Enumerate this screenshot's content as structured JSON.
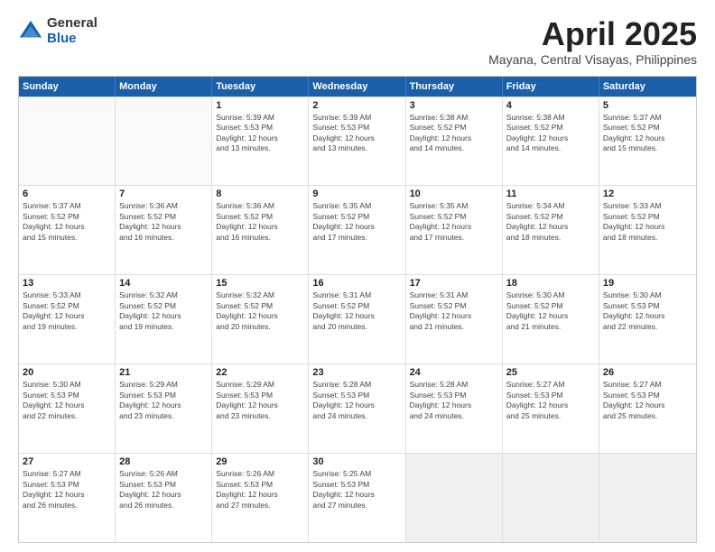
{
  "logo": {
    "general": "General",
    "blue": "Blue"
  },
  "title": {
    "month": "April 2025",
    "location": "Mayana, Central Visayas, Philippines"
  },
  "header_days": [
    "Sunday",
    "Monday",
    "Tuesday",
    "Wednesday",
    "Thursday",
    "Friday",
    "Saturday"
  ],
  "rows": [
    [
      {
        "day": "",
        "lines": [],
        "empty": true
      },
      {
        "day": "",
        "lines": [],
        "empty": true
      },
      {
        "day": "1",
        "lines": [
          "Sunrise: 5:39 AM",
          "Sunset: 5:53 PM",
          "Daylight: 12 hours",
          "and 13 minutes."
        ]
      },
      {
        "day": "2",
        "lines": [
          "Sunrise: 5:39 AM",
          "Sunset: 5:53 PM",
          "Daylight: 12 hours",
          "and 13 minutes."
        ]
      },
      {
        "day": "3",
        "lines": [
          "Sunrise: 5:38 AM",
          "Sunset: 5:52 PM",
          "Daylight: 12 hours",
          "and 14 minutes."
        ]
      },
      {
        "day": "4",
        "lines": [
          "Sunrise: 5:38 AM",
          "Sunset: 5:52 PM",
          "Daylight: 12 hours",
          "and 14 minutes."
        ]
      },
      {
        "day": "5",
        "lines": [
          "Sunrise: 5:37 AM",
          "Sunset: 5:52 PM",
          "Daylight: 12 hours",
          "and 15 minutes."
        ]
      }
    ],
    [
      {
        "day": "6",
        "lines": [
          "Sunrise: 5:37 AM",
          "Sunset: 5:52 PM",
          "Daylight: 12 hours",
          "and 15 minutes."
        ]
      },
      {
        "day": "7",
        "lines": [
          "Sunrise: 5:36 AM",
          "Sunset: 5:52 PM",
          "Daylight: 12 hours",
          "and 16 minutes."
        ]
      },
      {
        "day": "8",
        "lines": [
          "Sunrise: 5:36 AM",
          "Sunset: 5:52 PM",
          "Daylight: 12 hours",
          "and 16 minutes."
        ]
      },
      {
        "day": "9",
        "lines": [
          "Sunrise: 5:35 AM",
          "Sunset: 5:52 PM",
          "Daylight: 12 hours",
          "and 17 minutes."
        ]
      },
      {
        "day": "10",
        "lines": [
          "Sunrise: 5:35 AM",
          "Sunset: 5:52 PM",
          "Daylight: 12 hours",
          "and 17 minutes."
        ]
      },
      {
        "day": "11",
        "lines": [
          "Sunrise: 5:34 AM",
          "Sunset: 5:52 PM",
          "Daylight: 12 hours",
          "and 18 minutes."
        ]
      },
      {
        "day": "12",
        "lines": [
          "Sunrise: 5:33 AM",
          "Sunset: 5:52 PM",
          "Daylight: 12 hours",
          "and 18 minutes."
        ]
      }
    ],
    [
      {
        "day": "13",
        "lines": [
          "Sunrise: 5:33 AM",
          "Sunset: 5:52 PM",
          "Daylight: 12 hours",
          "and 19 minutes."
        ]
      },
      {
        "day": "14",
        "lines": [
          "Sunrise: 5:32 AM",
          "Sunset: 5:52 PM",
          "Daylight: 12 hours",
          "and 19 minutes."
        ]
      },
      {
        "day": "15",
        "lines": [
          "Sunrise: 5:32 AM",
          "Sunset: 5:52 PM",
          "Daylight: 12 hours",
          "and 20 minutes."
        ]
      },
      {
        "day": "16",
        "lines": [
          "Sunrise: 5:31 AM",
          "Sunset: 5:52 PM",
          "Daylight: 12 hours",
          "and 20 minutes."
        ]
      },
      {
        "day": "17",
        "lines": [
          "Sunrise: 5:31 AM",
          "Sunset: 5:52 PM",
          "Daylight: 12 hours",
          "and 21 minutes."
        ]
      },
      {
        "day": "18",
        "lines": [
          "Sunrise: 5:30 AM",
          "Sunset: 5:52 PM",
          "Daylight: 12 hours",
          "and 21 minutes."
        ]
      },
      {
        "day": "19",
        "lines": [
          "Sunrise: 5:30 AM",
          "Sunset: 5:53 PM",
          "Daylight: 12 hours",
          "and 22 minutes."
        ]
      }
    ],
    [
      {
        "day": "20",
        "lines": [
          "Sunrise: 5:30 AM",
          "Sunset: 5:53 PM",
          "Daylight: 12 hours",
          "and 22 minutes."
        ]
      },
      {
        "day": "21",
        "lines": [
          "Sunrise: 5:29 AM",
          "Sunset: 5:53 PM",
          "Daylight: 12 hours",
          "and 23 minutes."
        ]
      },
      {
        "day": "22",
        "lines": [
          "Sunrise: 5:29 AM",
          "Sunset: 5:53 PM",
          "Daylight: 12 hours",
          "and 23 minutes."
        ]
      },
      {
        "day": "23",
        "lines": [
          "Sunrise: 5:28 AM",
          "Sunset: 5:53 PM",
          "Daylight: 12 hours",
          "and 24 minutes."
        ]
      },
      {
        "day": "24",
        "lines": [
          "Sunrise: 5:28 AM",
          "Sunset: 5:53 PM",
          "Daylight: 12 hours",
          "and 24 minutes."
        ]
      },
      {
        "day": "25",
        "lines": [
          "Sunrise: 5:27 AM",
          "Sunset: 5:53 PM",
          "Daylight: 12 hours",
          "and 25 minutes."
        ]
      },
      {
        "day": "26",
        "lines": [
          "Sunrise: 5:27 AM",
          "Sunset: 5:53 PM",
          "Daylight: 12 hours",
          "and 25 minutes."
        ]
      }
    ],
    [
      {
        "day": "27",
        "lines": [
          "Sunrise: 5:27 AM",
          "Sunset: 5:53 PM",
          "Daylight: 12 hours",
          "and 26 minutes."
        ]
      },
      {
        "day": "28",
        "lines": [
          "Sunrise: 5:26 AM",
          "Sunset: 5:53 PM",
          "Daylight: 12 hours",
          "and 26 minutes."
        ]
      },
      {
        "day": "29",
        "lines": [
          "Sunrise: 5:26 AM",
          "Sunset: 5:53 PM",
          "Daylight: 12 hours",
          "and 27 minutes."
        ]
      },
      {
        "day": "30",
        "lines": [
          "Sunrise: 5:25 AM",
          "Sunset: 5:53 PM",
          "Daylight: 12 hours",
          "and 27 minutes."
        ]
      },
      {
        "day": "",
        "lines": [],
        "empty": true,
        "shaded": true
      },
      {
        "day": "",
        "lines": [],
        "empty": true,
        "shaded": true
      },
      {
        "day": "",
        "lines": [],
        "empty": true,
        "shaded": true
      }
    ]
  ]
}
